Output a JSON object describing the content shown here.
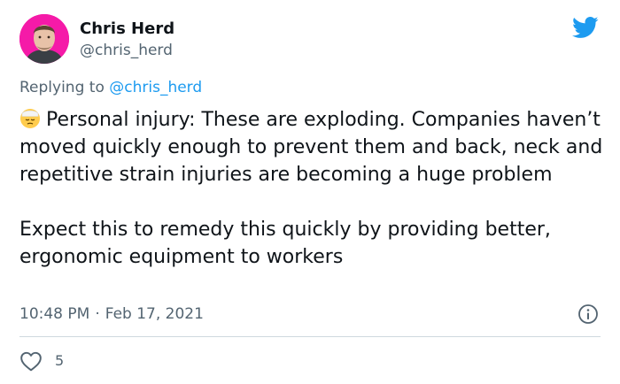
{
  "author": {
    "name": "Chris Herd",
    "handle": "@chris_herd"
  },
  "reply_context": {
    "prefix": "Replying to",
    "mention": "@chris_herd"
  },
  "tweet": {
    "paragraph_1": "Personal injury: These are exploding. Companies haven’t moved quickly enough to prevent them and back, neck and repetitive strain injuries are becoming a huge problem",
    "paragraph_2": "Expect this to remedy this quickly by providing better, ergonomic equipment to workers",
    "leading_emoji": "bandaged-face-emoji"
  },
  "timestamp": {
    "time": "10:48 PM",
    "separator": "·",
    "date": "Feb 17, 2021"
  },
  "engagement": {
    "likes": "5"
  },
  "icons": {
    "brand": "twitter-bird-icon",
    "info": "info-icon",
    "like": "heart-icon"
  },
  "colors": {
    "brand_blue": "#1d9bf0",
    "avatar_bg": "#f51aa8",
    "secondary_text": "#536471",
    "divider": "#cfd9de"
  }
}
